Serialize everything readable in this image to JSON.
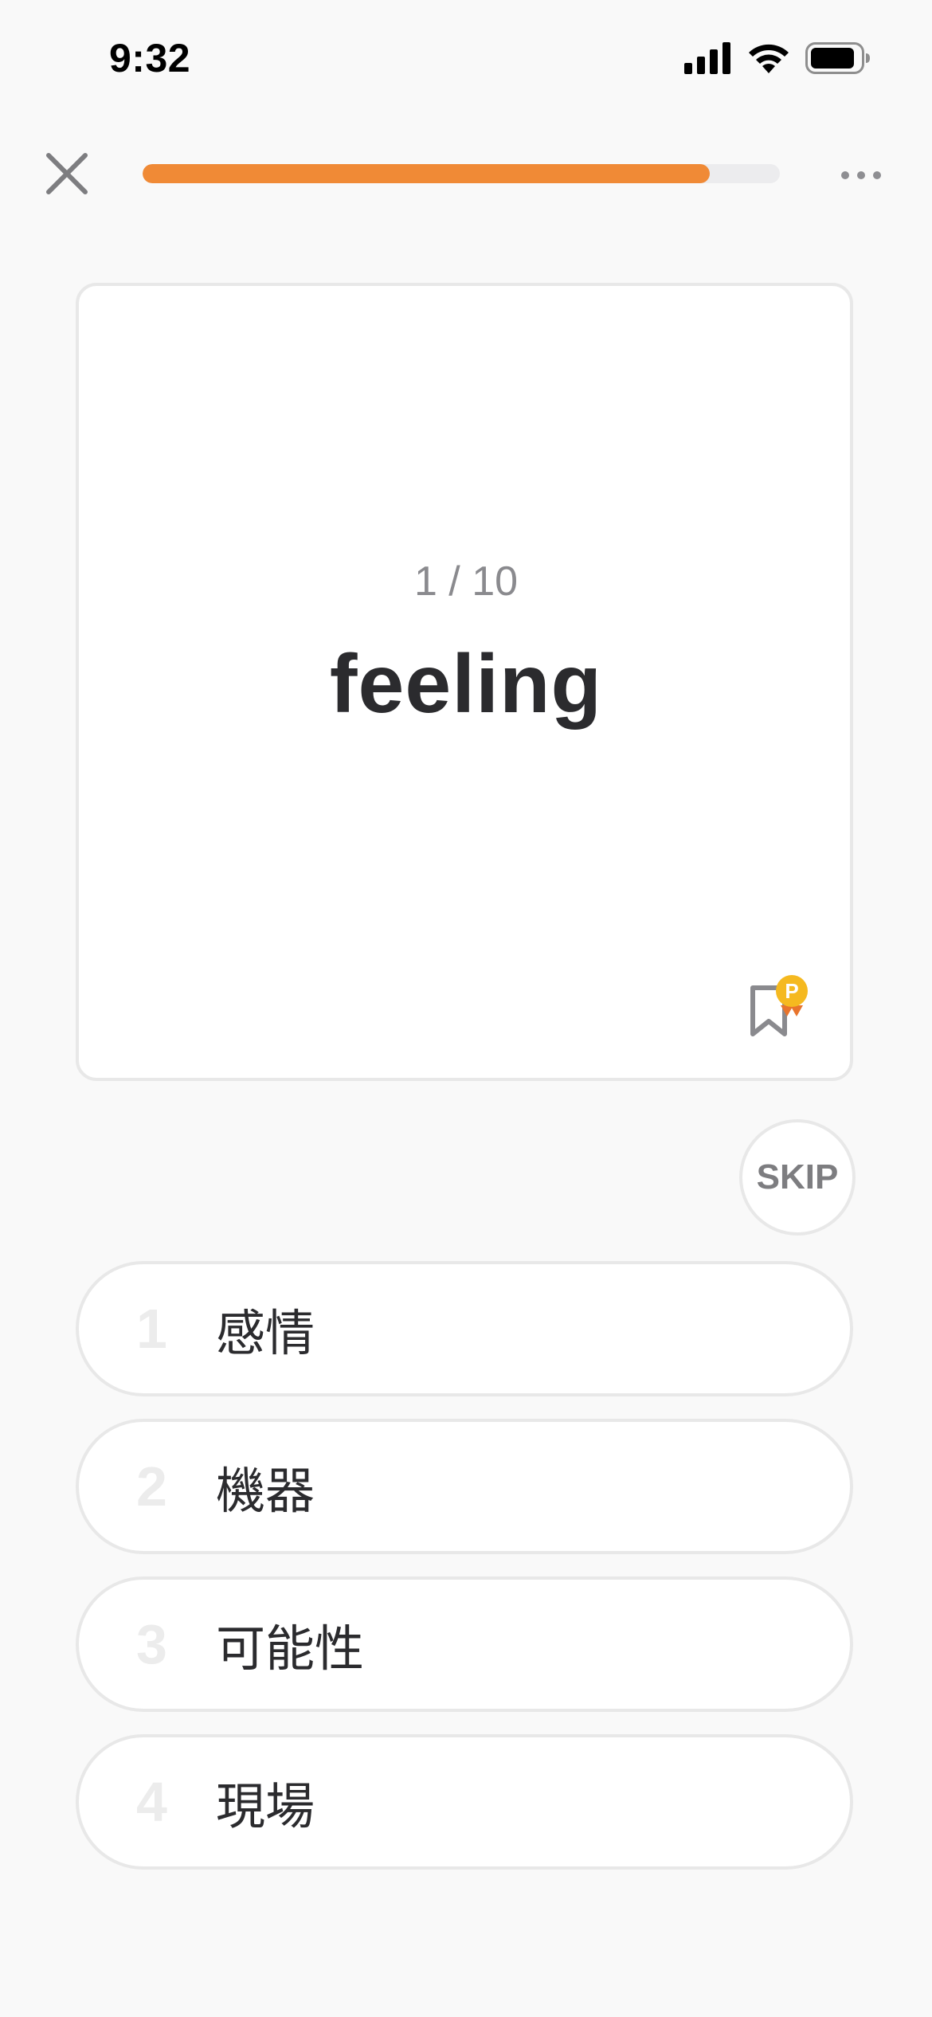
{
  "status_bar": {
    "time": "9:32",
    "icons": [
      "cellular-signal-icon",
      "wifi-icon",
      "battery-icon"
    ]
  },
  "top_bar": {
    "close_icon": "close-icon",
    "progress_fraction": 0.89,
    "more_icon": "more-horizontal-icon"
  },
  "card": {
    "counter": "1 / 10",
    "word": "feeling",
    "bookmark_icon": "bookmark-premium-icon",
    "bookmark_badge": "P"
  },
  "skip": {
    "label": "SKIP"
  },
  "options": [
    {
      "number": "1",
      "text": "感情"
    },
    {
      "number": "2",
      "text": "機器"
    },
    {
      "number": "3",
      "text": "可能性"
    },
    {
      "number": "4",
      "text": "現場"
    }
  ],
  "colors": {
    "accent": "#f08a36",
    "background": "#f9f9f9",
    "badge": "#f5b920"
  }
}
